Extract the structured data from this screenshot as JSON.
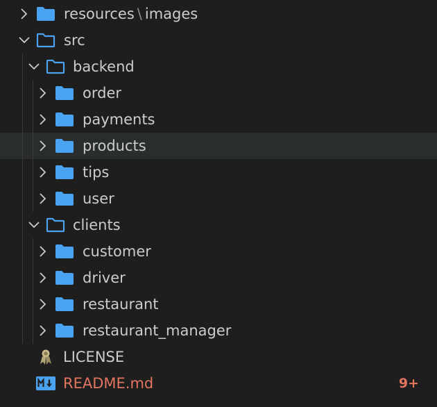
{
  "explorer": {
    "items": [
      {
        "label": "resources",
        "label_suffix": "images",
        "separator": "\\",
        "kind": "folder",
        "expanded": false,
        "depth": 0
      },
      {
        "label": "src",
        "kind": "folder",
        "expanded": true,
        "depth": 0
      },
      {
        "label": "backend",
        "kind": "folder",
        "expanded": true,
        "depth": 1
      },
      {
        "label": "order",
        "kind": "folder",
        "expanded": false,
        "depth": 2
      },
      {
        "label": "payments",
        "kind": "folder",
        "expanded": false,
        "depth": 2
      },
      {
        "label": "products",
        "kind": "folder",
        "expanded": false,
        "depth": 2,
        "hovered": true
      },
      {
        "label": "tips",
        "kind": "folder",
        "expanded": false,
        "depth": 2
      },
      {
        "label": "user",
        "kind": "folder",
        "expanded": false,
        "depth": 2
      },
      {
        "label": "clients",
        "kind": "folder",
        "expanded": true,
        "depth": 1
      },
      {
        "label": "customer",
        "kind": "folder",
        "expanded": false,
        "depth": 2
      },
      {
        "label": "driver",
        "kind": "folder",
        "expanded": false,
        "depth": 2
      },
      {
        "label": "restaurant",
        "kind": "folder",
        "expanded": false,
        "depth": 2
      },
      {
        "label": "restaurant_manager",
        "kind": "folder",
        "expanded": false,
        "depth": 2
      },
      {
        "label": "LICENSE",
        "kind": "license-file",
        "depth": 0
      },
      {
        "label": "README.md",
        "kind": "markdown-file",
        "depth": 0,
        "modified": true,
        "badge": "9+"
      }
    ]
  },
  "colors": {
    "background": "#1e1e1e",
    "hover": "#2a2d2e",
    "text": "#cccccc",
    "folder": "#4aa3f0",
    "modified": "#e2755f",
    "markdown_icon": "#4aa3f0"
  },
  "icons": {
    "collapsed": "chevron-right-icon",
    "expanded": "chevron-down-icon",
    "folder_closed": "folder-icon",
    "folder_open": "folder-open-icon",
    "license": "license-ribbon-icon",
    "markdown": "markdown-icon"
  }
}
